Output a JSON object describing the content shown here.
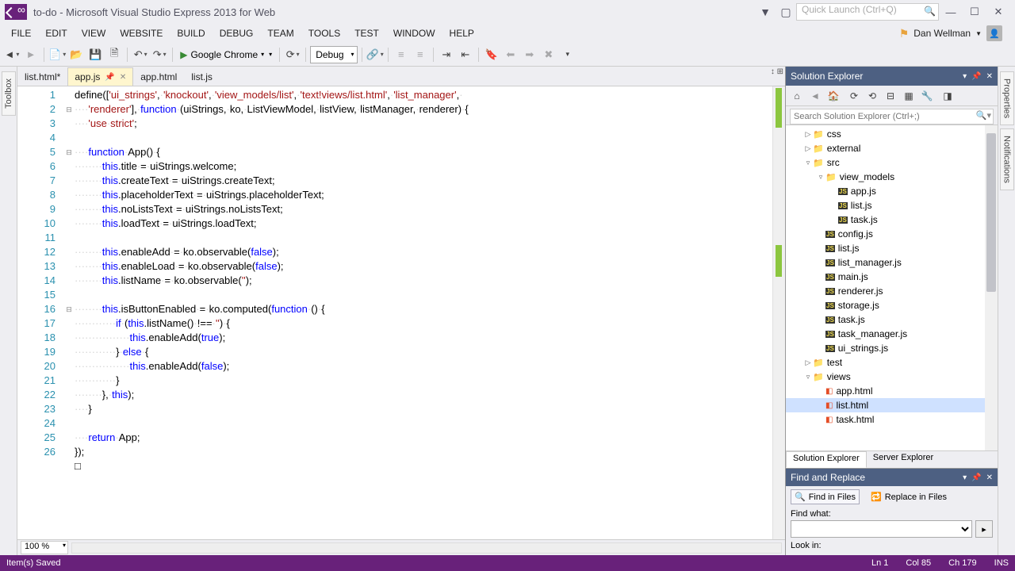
{
  "title": "to-do - Microsoft Visual Studio Express 2013 for Web",
  "quicklaunch_placeholder": "Quick Launch (Ctrl+Q)",
  "menus": [
    "FILE",
    "EDIT",
    "VIEW",
    "WEBSITE",
    "BUILD",
    "DEBUG",
    "TEAM",
    "TOOLS",
    "TEST",
    "WINDOW",
    "HELP"
  ],
  "user_name": "Dan Wellman",
  "toolbar": {
    "browser": "Google Chrome",
    "config": "Debug"
  },
  "side_left": "Toolbox",
  "side_right_tabs": [
    "Properties",
    "Notifications"
  ],
  "tabs": [
    {
      "label": "list.html*",
      "active": false,
      "modified": true
    },
    {
      "label": "app.js",
      "active": true,
      "modified": false
    },
    {
      "label": "app.html",
      "active": false,
      "modified": false
    },
    {
      "label": "list.js",
      "active": false,
      "modified": false
    }
  ],
  "code_lines": [
    {
      "n": 1,
      "fold": "",
      "html": "define([<span class='str'>'ui_strings'</span>,·<span class='str'>'knockout'</span>,·<span class='str'>'view_models/list'</span>,·<span class='str'>'text!views/list.html'</span>,·<span class='str'>'list_manager'</span>,·"
    },
    {
      "n": 2,
      "fold": "⊟",
      "html": "····<span class='str'>'renderer'</span>],·<span class='kw'>function</span>·(uiStrings,·ko,·ListViewModel,·listView,·listManager,·renderer)·{"
    },
    {
      "n": 3,
      "fold": "",
      "html": "····<span class='str'>'use·strict'</span>;"
    },
    {
      "n": 4,
      "fold": "",
      "html": ""
    },
    {
      "n": 5,
      "fold": "⊟",
      "html": "····<span class='kw'>function</span>·App()·{"
    },
    {
      "n": 6,
      "fold": "",
      "html": "········<span class='kw'>this</span>.title·=·uiStrings.welcome;"
    },
    {
      "n": 7,
      "fold": "",
      "html": "········<span class='kw'>this</span>.createText·=·uiStrings.createText;"
    },
    {
      "n": 8,
      "fold": "",
      "html": "········<span class='kw'>this</span>.placeholderText·=·uiStrings.placeholderText;"
    },
    {
      "n": 9,
      "fold": "",
      "html": "········<span class='kw'>this</span>.noListsText·=·uiStrings.noListsText;"
    },
    {
      "n": 10,
      "fold": "",
      "html": "········<span class='kw'>this</span>.loadText·=·uiStrings.loadText;"
    },
    {
      "n": 11,
      "fold": "",
      "html": ""
    },
    {
      "n": 12,
      "fold": "",
      "html": "········<span class='kw'>this</span>.enableAdd·=·ko.observable(<span class='kw'>false</span>);"
    },
    {
      "n": 13,
      "fold": "",
      "html": "········<span class='kw'>this</span>.enableLoad·=·ko.observable(<span class='kw'>false</span>);"
    },
    {
      "n": 14,
      "fold": "",
      "html": "········<span class='kw'>this</span>.listName·=·ko.observable(<span class='str'>''</span>);"
    },
    {
      "n": 15,
      "fold": "",
      "html": ""
    },
    {
      "n": 16,
      "fold": "⊟",
      "html": "········<span class='kw'>this</span>.isButtonEnabled·=·ko.computed(<span class='kw'>function</span>·()·{"
    },
    {
      "n": 17,
      "fold": "",
      "html": "············<span class='kw'>if</span>·(<span class='kw'>this</span>.listName()·!==·<span class='str'>''</span>)·{"
    },
    {
      "n": 18,
      "fold": "",
      "html": "················<span class='kw'>this</span>.enableAdd(<span class='kw'>true</span>);"
    },
    {
      "n": 19,
      "fold": "",
      "html": "············}·<span class='kw'>else</span>·{"
    },
    {
      "n": 20,
      "fold": "",
      "html": "················<span class='kw'>this</span>.enableAdd(<span class='kw'>false</span>);"
    },
    {
      "n": 21,
      "fold": "",
      "html": "············}"
    },
    {
      "n": 22,
      "fold": "",
      "html": "········},·<span class='kw'>this</span>);"
    },
    {
      "n": 23,
      "fold": "",
      "html": "····}"
    },
    {
      "n": 24,
      "fold": "",
      "html": ""
    },
    {
      "n": 25,
      "fold": "",
      "html": "····<span class='kw'>return</span>·App;"
    },
    {
      "n": 26,
      "fold": "",
      "html": "});"
    },
    {
      "n": "",
      "fold": "",
      "html": "□"
    }
  ],
  "zoom": "100 %",
  "solution_explorer": {
    "title": "Solution Explorer",
    "search_placeholder": "Search Solution Explorer (Ctrl+;)",
    "nodes": [
      {
        "depth": 1,
        "tw": "▷",
        "icon": "folder",
        "label": "css"
      },
      {
        "depth": 1,
        "tw": "▷",
        "icon": "folder",
        "label": "external"
      },
      {
        "depth": 1,
        "tw": "▿",
        "icon": "folder",
        "label": "src"
      },
      {
        "depth": 2,
        "tw": "▿",
        "icon": "folder",
        "label": "view_models"
      },
      {
        "depth": 3,
        "tw": "",
        "icon": "js",
        "label": "app.js"
      },
      {
        "depth": 3,
        "tw": "",
        "icon": "js",
        "label": "list.js"
      },
      {
        "depth": 3,
        "tw": "",
        "icon": "js",
        "label": "task.js"
      },
      {
        "depth": 2,
        "tw": "",
        "icon": "js",
        "label": "config.js"
      },
      {
        "depth": 2,
        "tw": "",
        "icon": "js",
        "label": "list.js"
      },
      {
        "depth": 2,
        "tw": "",
        "icon": "js",
        "label": "list_manager.js"
      },
      {
        "depth": 2,
        "tw": "",
        "icon": "js",
        "label": "main.js"
      },
      {
        "depth": 2,
        "tw": "",
        "icon": "js",
        "label": "renderer.js"
      },
      {
        "depth": 2,
        "tw": "",
        "icon": "js",
        "label": "storage.js"
      },
      {
        "depth": 2,
        "tw": "",
        "icon": "js",
        "label": "task.js"
      },
      {
        "depth": 2,
        "tw": "",
        "icon": "js",
        "label": "task_manager.js"
      },
      {
        "depth": 2,
        "tw": "",
        "icon": "js",
        "label": "ui_strings.js"
      },
      {
        "depth": 1,
        "tw": "▷",
        "icon": "folder",
        "label": "test"
      },
      {
        "depth": 1,
        "tw": "▿",
        "icon": "folder",
        "label": "views"
      },
      {
        "depth": 2,
        "tw": "",
        "icon": "html",
        "label": "app.html"
      },
      {
        "depth": 2,
        "tw": "",
        "icon": "html",
        "label": "list.html",
        "sel": true
      },
      {
        "depth": 2,
        "tw": "",
        "icon": "html",
        "label": "task.html"
      }
    ],
    "tabs": [
      "Solution Explorer",
      "Server Explorer"
    ]
  },
  "find": {
    "title": "Find and Replace",
    "mode_find": "Find in Files",
    "mode_replace": "Replace in Files",
    "what_label": "Find what:",
    "lookin_label": "Look in:"
  },
  "status": {
    "left": "Item(s) Saved",
    "ln": "Ln 1",
    "col": "Col 85",
    "ch": "Ch 179",
    "ins": "INS"
  }
}
